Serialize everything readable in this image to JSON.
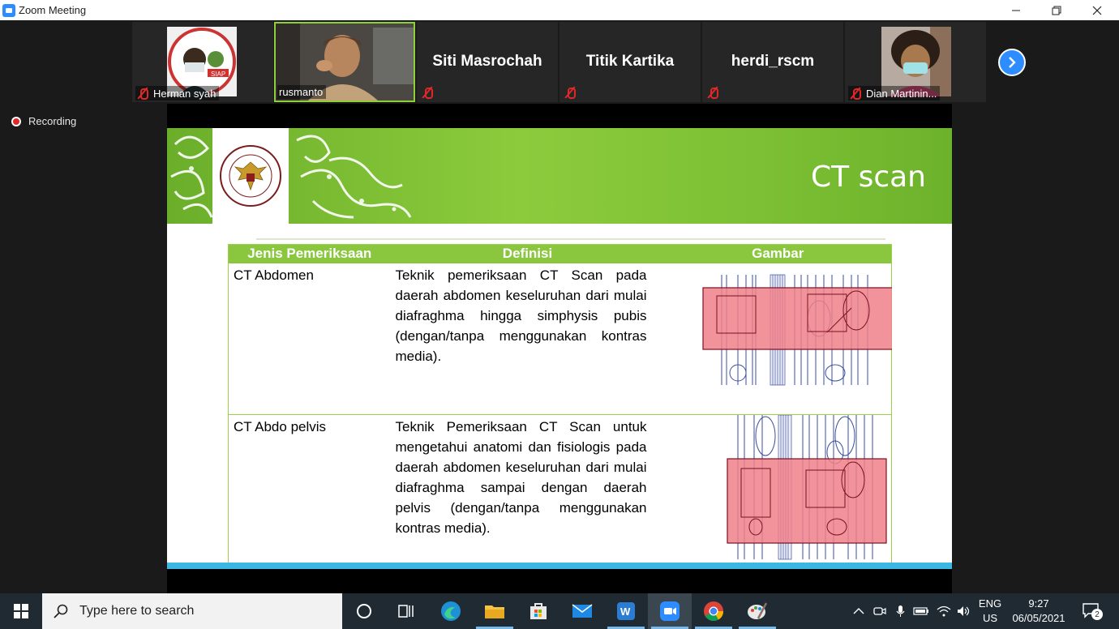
{
  "window": {
    "title": "Zoom Meeting"
  },
  "participants": [
    {
      "name": "Herman syah",
      "has_video": true,
      "muted": true
    },
    {
      "name": "rusmanto",
      "has_video": true,
      "muted": false,
      "active_speaker": true
    },
    {
      "name": "Siti Masrochah",
      "has_video": false,
      "muted": true
    },
    {
      "name": "Titik Kartika",
      "has_video": false,
      "muted": true
    },
    {
      "name": "herdi_rscm",
      "has_video": false,
      "muted": true
    },
    {
      "name": "Dian Martinin...",
      "has_video": true,
      "muted": true
    }
  ],
  "recording": {
    "label": "Recording"
  },
  "slide": {
    "title": "CT scan",
    "table": {
      "headers": [
        "Jenis Pemeriksaan",
        "Definisi",
        "Gambar"
      ],
      "rows": [
        {
          "jenis": "CT Abdomen",
          "definisi": "Teknik pemeriksaan CT Scan pada daerah abdomen keseluruhan dari mulai diafraghma hingga simphysis pubis (dengan/tanpa menggunakan kontras media)."
        },
        {
          "jenis": "CT Abdo pelvis",
          "definisi": "Teknik Pemeriksaan CT Scan untuk mengetahui anatomi dan fisiologis pada daerah abdomen keseluruhan dari mulai diafraghma sampai dengan daerah pelvis (dengan/tanpa menggunakan kontras media)."
        }
      ]
    },
    "colors": {
      "banner_green": "#8ccb3c",
      "highlight_red": "#f0808a",
      "bottom_blue": "#3cb6e3"
    }
  },
  "taskbar": {
    "search_placeholder": "Type here to search",
    "language": "ENG",
    "region": "US",
    "time": "9:27",
    "date": "06/05/2021",
    "notification_count": "2",
    "apps": [
      "cortana-icon",
      "task-view-icon",
      "edge-icon",
      "file-explorer-icon",
      "store-icon",
      "mail-icon",
      "wps-writer-icon",
      "zoom-icon",
      "chrome-icon",
      "paint-icon"
    ]
  }
}
